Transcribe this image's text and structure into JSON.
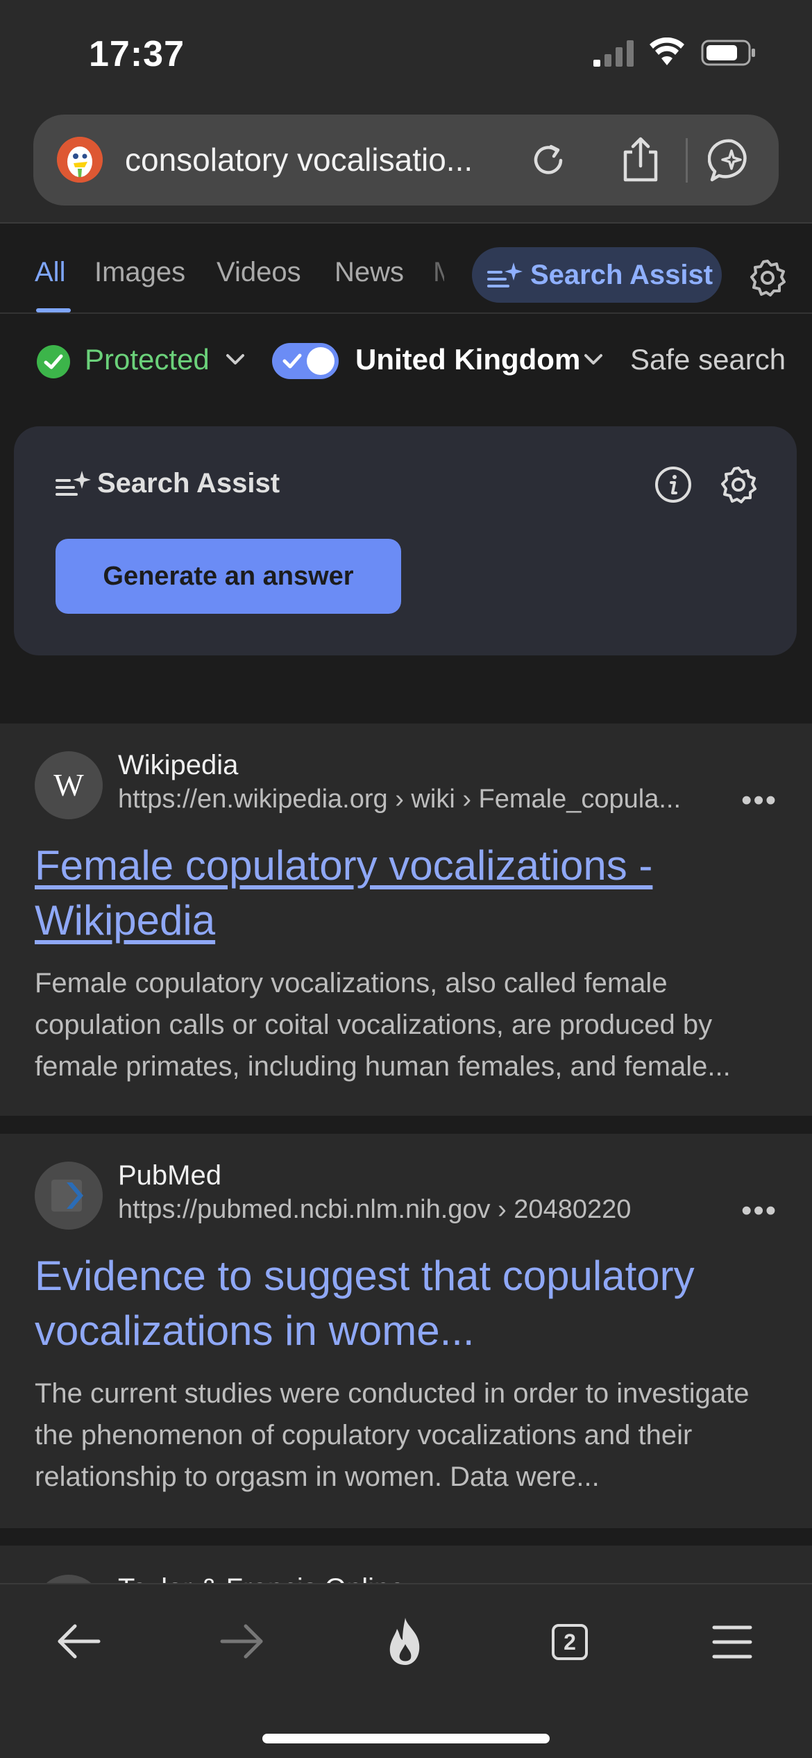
{
  "status_bar": {
    "time": "17:37"
  },
  "address_bar": {
    "query": "consolatory vocalisatio..."
  },
  "tabs": [
    {
      "label": "All",
      "active": true
    },
    {
      "label": "Images"
    },
    {
      "label": "Videos"
    },
    {
      "label": "News"
    },
    {
      "label": "M"
    }
  ],
  "search_assist_pill": {
    "label": "Search Assist"
  },
  "filters": {
    "protection": "Protected",
    "region": "United Kingdom",
    "region_toggle_on": true,
    "safe_search": "Safe search"
  },
  "assist_card": {
    "title": "Search Assist",
    "button": "Generate an answer"
  },
  "results": [
    {
      "site": "Wikipedia",
      "favicon": "W",
      "url": "https://en.wikipedia.org › wiki › Female_copula...",
      "title": "Female copulatory vocalizations - Wikipedia",
      "snippet": "Female copulatory vocalizations, also called female copulation calls or coital vocalizations, are produced by female primates, including human females, and female..."
    },
    {
      "site": "PubMed",
      "url": "https://pubmed.ncbi.nlm.nih.gov › 20480220",
      "title": "Evidence to suggest that copulatory vocalizations in wome...",
      "snippet": "The current studies were conducted in order to investigate the phenomenon of copulatory vocalizations and their relationship to orgasm in women. Data were..."
    },
    {
      "site": "Taylor & Francis Online"
    }
  ],
  "toolbar": {
    "tab_count": "2"
  },
  "colors": {
    "accent": "#6b8cf5",
    "link": "#8fa8f7",
    "protected_green": "#6bd17a",
    "background": "#1c1c1c",
    "card": "#2a2a2a",
    "ddg_orange": "#de5833"
  }
}
